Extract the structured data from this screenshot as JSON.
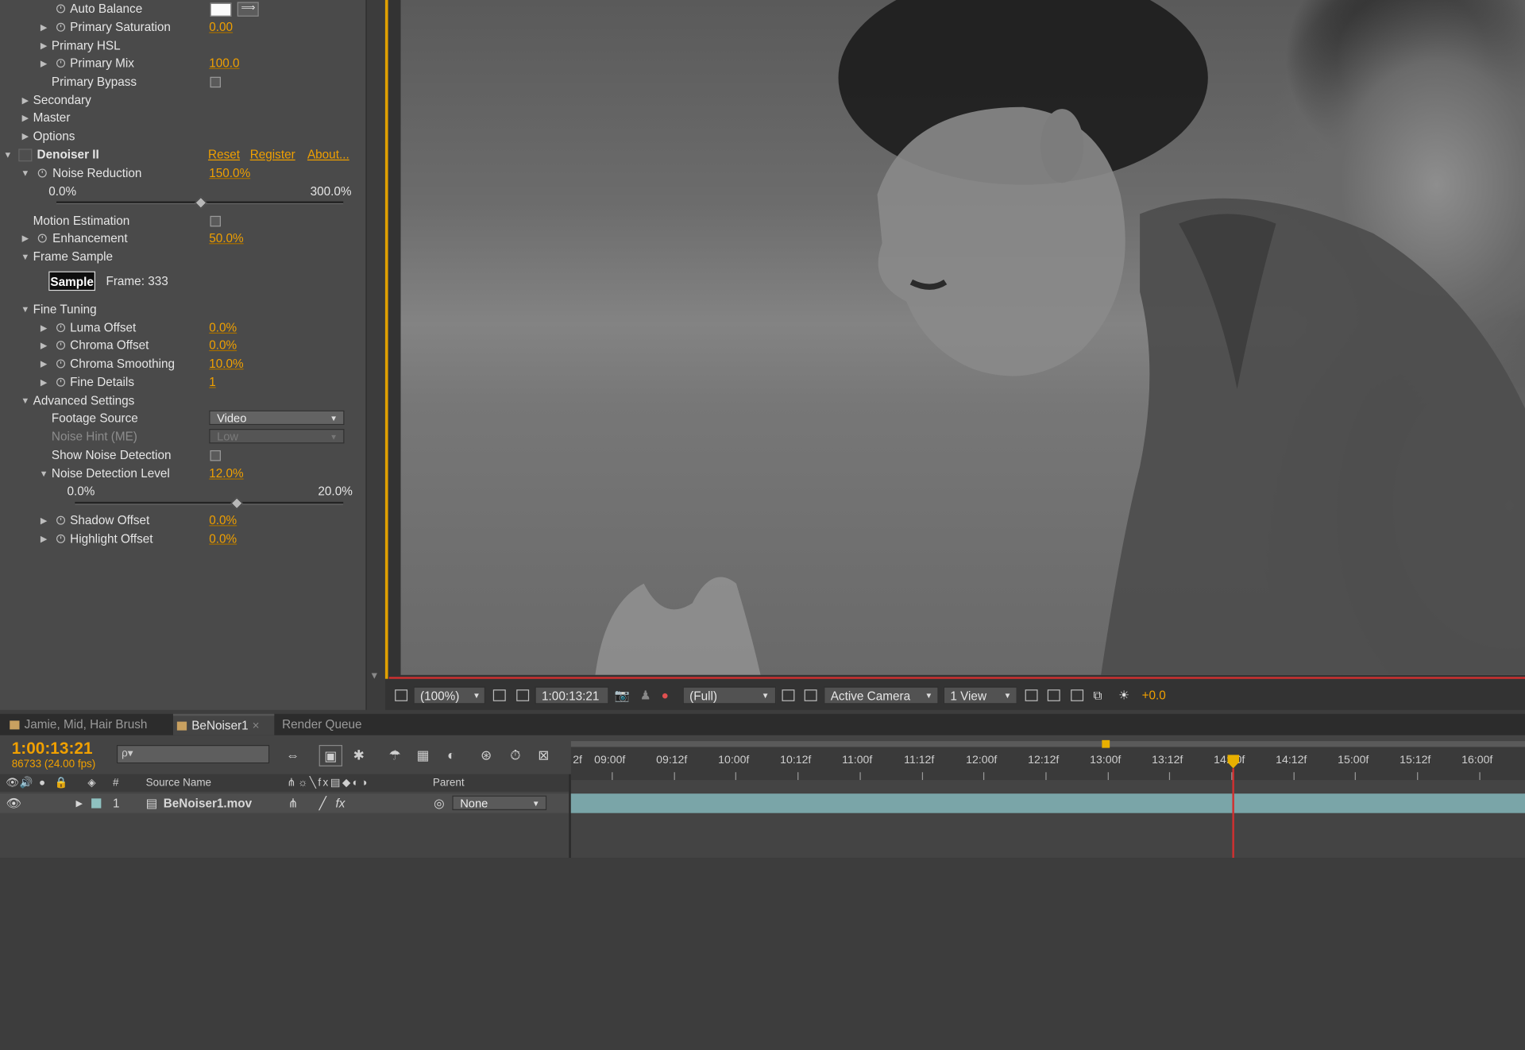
{
  "effects": {
    "rows": [
      {
        "label": "Auto Balance",
        "indent": 2,
        "stopwatch": true,
        "swatch": true
      },
      {
        "label": "Primary Saturation",
        "indent": 2,
        "twirl": "closed",
        "stopwatch": true,
        "value": "0.00"
      },
      {
        "label": "Primary HSL",
        "indent": 2,
        "twirl": "closed"
      },
      {
        "label": "Primary Mix",
        "indent": 2,
        "twirl": "closed",
        "stopwatch": true,
        "value": "100.0"
      },
      {
        "label": "Primary Bypass",
        "indent": 2,
        "checkbox": true
      },
      {
        "label": "Secondary",
        "indent": 1,
        "twirl": "closed"
      },
      {
        "label": "Master",
        "indent": 1,
        "twirl": "closed"
      },
      {
        "label": "Options",
        "indent": 1,
        "twirl": "closed"
      }
    ],
    "denoiser": {
      "name": "Denoiser II",
      "reset": "Reset",
      "register": "Register",
      "about": "About..."
    },
    "noise_reduction": {
      "label": "Noise Reduction",
      "value": "150.0%",
      "min": "0.0%",
      "max": "300.0%",
      "fraction": 0.5
    },
    "motion_estimation": {
      "label": "Motion Estimation"
    },
    "enhancement": {
      "label": "Enhancement",
      "value": "50.0%"
    },
    "frame_sample": {
      "label": "Frame Sample",
      "button": "Sample",
      "frame": "Frame: 333"
    },
    "fine_tuning": {
      "label": "Fine Tuning",
      "items": [
        {
          "label": "Luma Offset",
          "value": "0.0%"
        },
        {
          "label": "Chroma Offset",
          "value": "0.0%"
        },
        {
          "label": "Chroma Smoothing",
          "value": "10.0%"
        },
        {
          "label": "Fine Details",
          "value": "1"
        }
      ]
    },
    "advanced": {
      "label": "Advanced Settings",
      "footage_source": {
        "label": "Footage Source",
        "value": "Video"
      },
      "noise_hint": {
        "label": "Noise Hint (ME)",
        "value": "Low"
      },
      "show_noise": {
        "label": "Show Noise Detection"
      },
      "noise_level": {
        "label": "Noise Detection Level",
        "value": "12.0%",
        "min": "0.0%",
        "max": "20.0%",
        "fraction": 0.6
      },
      "shadow": {
        "label": "Shadow Offset",
        "value": "0.0%"
      },
      "highlight": {
        "label": "Highlight Offset",
        "value": "0.0%"
      }
    }
  },
  "viewer": {
    "zoom": "(100%)",
    "timecode": "1:00:13:21",
    "resolution": "(Full)",
    "camera": "Active Camera",
    "views": "1 View",
    "exposure": "+0.0"
  },
  "tabs": [
    {
      "label": "Jamie, Mid, Hair Brush",
      "color": "#c8a060",
      "active": false
    },
    {
      "label": "BeNoiser1",
      "color": "#c8a060",
      "active": true
    },
    {
      "label": "Render Queue",
      "color": "",
      "active": false
    }
  ],
  "timeline": {
    "timecode": "1:00:13:21",
    "framecount": "86733 (24.00 fps)",
    "search_placeholder": "ρ▾",
    "columns": {
      "source": "Source Name",
      "parent": "Parent",
      "num": "#"
    },
    "layer": {
      "num": "1",
      "name": "BeNoiser1.mov",
      "parent": "None"
    },
    "ticks": [
      "2f",
      "09:00f",
      "09:12f",
      "10:00f",
      "10:12f",
      "11:00f",
      "11:12f",
      "12:00f",
      "12:12f",
      "13:00f",
      "13:12f",
      "14:00f",
      "14:12f",
      "15:00f",
      "15:12f",
      "16:00f"
    ]
  },
  "colors": {
    "accent": "#f0a000",
    "panel": "#4a4a4a",
    "cti": "#d03030"
  }
}
